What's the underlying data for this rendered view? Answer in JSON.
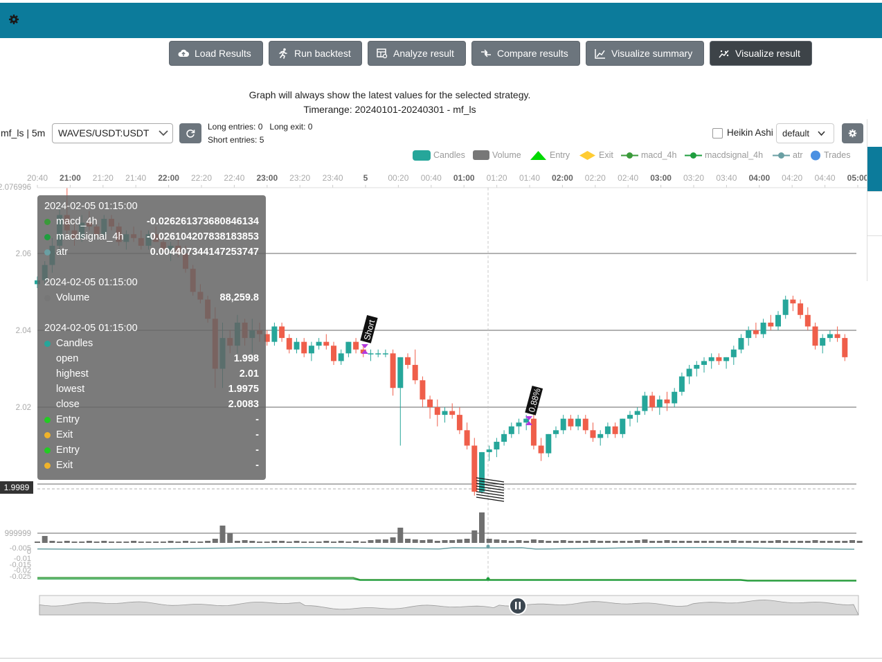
{
  "toolbar": {
    "buttons": [
      {
        "label": "Load Results",
        "icon": "cloud-upload-icon"
      },
      {
        "label": "Run backtest",
        "icon": "running-icon"
      },
      {
        "label": "Analyze result",
        "icon": "table-analyze-icon"
      },
      {
        "label": "Compare results",
        "icon": "compare-icon"
      },
      {
        "label": "Visualize summary",
        "icon": "line-chart-icon"
      },
      {
        "label": "Visualize result",
        "icon": "scatter-chart-icon"
      }
    ]
  },
  "info": {
    "graph_note": "Graph will always show the latest values for the selected strategy.",
    "timerange": "Timerange: 20240101-20240301 - mf_ls"
  },
  "controls": {
    "strategy_label": "mf_ls | 5m",
    "pair": "WAVES/USDT:USDT",
    "long_entries": "Long entries: 0",
    "long_exit": "Long exit: 0",
    "short_entries": "Short entries: 5",
    "heikin_ashi": "Heikin Ashi",
    "layout": "default"
  },
  "legend": [
    {
      "label": "Candles",
      "color": "#26a69a"
    },
    {
      "label": "Volume",
      "color": "#777777"
    },
    {
      "label": "Entry",
      "color": "#00d900"
    },
    {
      "label": "Exit",
      "color": "#ffcc33"
    },
    {
      "label": "macd_4h",
      "color": "#3a9a3a"
    },
    {
      "label": "macdsignal_4h",
      "color": "#1e9e3e"
    },
    {
      "label": "atr",
      "color": "#6a9fa3"
    },
    {
      "label": "Trades",
      "color": "#4a90e2"
    }
  ],
  "chart_data": {
    "type": "candlestick",
    "x_ticks": [
      "20:40",
      "21:00",
      "21:20",
      "21:40",
      "22:00",
      "22:20",
      "22:40",
      "23:00",
      "23:20",
      "23:40",
      "5",
      "00:20",
      "00:40",
      "01:00",
      "01:20",
      "01:40",
      "02:00",
      "02:20",
      "02:40",
      "03:00",
      "03:20",
      "03:40",
      "04:00",
      "04:20",
      "04:40",
      "05:00"
    ],
    "y_ticks": [
      "2.076996",
      "2.06",
      "2.04",
      "2.02"
    ],
    "volume_ticks": [
      "999999"
    ],
    "indicator_ticks": [
      "-0.005",
      "0",
      "-0.01",
      "-0.015",
      "-0.02",
      "-0.025"
    ],
    "current_price": "1.9989",
    "markers": [
      {
        "label": "Short",
        "time": "00:00"
      },
      {
        "label": "0.88%",
        "time": "01:40"
      }
    ],
    "candles": [
      [
        2.052,
        2.054,
        2.051,
        2.053
      ],
      [
        2.053,
        2.058,
        2.052,
        2.057
      ],
      [
        2.057,
        2.064,
        2.055,
        2.062
      ],
      [
        2.062,
        2.072,
        2.06,
        2.07
      ],
      [
        2.07,
        2.077,
        2.065,
        2.066
      ],
      [
        2.066,
        2.068,
        2.062,
        2.064
      ],
      [
        2.064,
        2.07,
        2.063,
        2.068
      ],
      [
        2.068,
        2.071,
        2.066,
        2.067
      ],
      [
        2.067,
        2.069,
        2.064,
        2.065
      ],
      [
        2.065,
        2.07,
        2.064,
        2.069
      ],
      [
        2.069,
        2.07,
        2.066,
        2.067
      ],
      [
        2.067,
        2.068,
        2.062,
        2.063
      ],
      [
        2.063,
        2.066,
        2.061,
        2.065
      ],
      [
        2.065,
        2.067,
        2.063,
        2.064
      ],
      [
        2.064,
        2.066,
        2.061,
        2.062
      ],
      [
        2.062,
        2.066,
        2.061,
        2.065
      ],
      [
        2.065,
        2.067,
        2.063,
        2.063
      ],
      [
        2.063,
        2.064,
        2.06,
        2.061
      ],
      [
        2.061,
        2.063,
        2.058,
        2.062
      ],
      [
        2.062,
        2.064,
        2.059,
        2.06
      ],
      [
        2.06,
        2.062,
        2.055,
        2.056
      ],
      [
        2.056,
        2.057,
        2.049,
        2.05
      ],
      [
        2.05,
        2.052,
        2.047,
        2.048
      ],
      [
        2.048,
        2.049,
        2.042,
        2.043
      ],
      [
        2.043,
        2.046,
        2.025,
        2.03
      ],
      [
        2.03,
        2.042,
        2.025,
        2.038
      ],
      [
        2.038,
        2.04,
        2.034,
        2.036
      ],
      [
        2.036,
        2.044,
        2.034,
        2.042
      ],
      [
        2.042,
        2.043,
        2.036,
        2.038
      ],
      [
        2.038,
        2.043,
        2.034,
        2.04
      ],
      [
        2.04,
        2.042,
        2.037,
        2.039
      ],
      [
        2.039,
        2.04,
        2.036,
        2.037
      ],
      [
        2.037,
        2.042,
        2.036,
        2.041
      ],
      [
        2.041,
        2.042,
        2.037,
        2.038
      ],
      [
        2.038,
        2.039,
        2.034,
        2.035
      ],
      [
        2.035,
        2.038,
        2.034,
        2.037
      ],
      [
        2.037,
        2.038,
        2.033,
        2.034
      ],
      [
        2.034,
        2.037,
        2.032,
        2.036
      ],
      [
        2.036,
        2.038,
        2.035,
        2.037
      ],
      [
        2.037,
        2.039,
        2.035,
        2.036
      ],
      [
        2.036,
        2.037,
        2.031,
        2.032
      ],
      [
        2.032,
        2.035,
        2.031,
        2.034
      ],
      [
        2.034,
        2.037,
        2.033,
        2.037
      ],
      [
        2.037,
        2.038,
        2.034,
        2.035
      ],
      [
        2.035,
        2.036,
        2.033,
        2.034
      ],
      [
        2.034,
        2.035,
        2.032,
        2.034
      ],
      [
        2.034,
        2.035,
        2.033,
        2.034
      ],
      [
        2.034,
        2.035,
        2.033,
        2.034
      ],
      [
        2.034,
        2.035,
        2.023,
        2.025
      ],
      [
        2.025,
        2.033,
        2.01,
        2.033
      ],
      [
        2.033,
        2.034,
        2.03,
        2.031
      ],
      [
        2.031,
        2.035,
        2.026,
        2.027
      ],
      [
        2.027,
        2.028,
        2.02,
        2.022
      ],
      [
        2.022,
        2.023,
        2.017,
        2.02
      ],
      [
        2.02,
        2.022,
        2.015,
        2.018
      ],
      [
        2.018,
        2.02,
        2.016,
        2.019
      ],
      [
        2.019,
        2.021,
        2.017,
        2.018
      ],
      [
        2.018,
        2.02,
        2.013,
        2.014
      ],
      [
        2.014,
        2.016,
        2.009,
        2.01
      ],
      [
        2.01,
        2.012,
        1.997,
        1.998
      ],
      [
        1.998,
        2.0083,
        1.9975,
        2.0083
      ],
      [
        2.0083,
        2.01,
        2.006,
        2.009
      ],
      [
        2.009,
        2.012,
        2.007,
        2.011
      ],
      [
        2.011,
        2.014,
        2.01,
        2.013
      ],
      [
        2.013,
        2.016,
        2.012,
        2.015
      ],
      [
        2.015,
        2.017,
        2.013,
        2.016
      ],
      [
        2.016,
        2.018,
        2.014,
        2.017
      ],
      [
        2.017,
        2.018,
        2.009,
        2.01
      ],
      [
        2.01,
        2.012,
        2.006,
        2.008
      ],
      [
        2.008,
        2.013,
        2.007,
        2.013
      ],
      [
        2.013,
        2.015,
        2.012,
        2.014
      ],
      [
        2.014,
        2.018,
        2.013,
        2.017
      ],
      [
        2.017,
        2.018,
        2.014,
        2.015
      ],
      [
        2.015,
        2.018,
        2.014,
        2.017
      ],
      [
        2.017,
        2.018,
        2.013,
        2.014
      ],
      [
        2.014,
        2.016,
        2.011,
        2.012
      ],
      [
        2.012,
        2.014,
        2.01,
        2.013
      ],
      [
        2.013,
        2.016,
        2.012,
        2.015
      ],
      [
        2.015,
        2.016,
        2.012,
        2.013
      ],
      [
        2.013,
        2.017,
        2.012,
        2.017
      ],
      [
        2.017,
        2.019,
        2.015,
        2.018
      ],
      [
        2.018,
        2.02,
        2.016,
        2.019
      ],
      [
        2.019,
        2.024,
        2.018,
        2.023
      ],
      [
        2.023,
        2.024,
        2.019,
        2.02
      ],
      [
        2.02,
        2.023,
        2.018,
        2.022
      ],
      [
        2.022,
        2.024,
        2.019,
        2.021
      ],
      [
        2.021,
        2.025,
        2.02,
        2.024
      ],
      [
        2.024,
        2.029,
        2.023,
        2.028
      ],
      [
        2.028,
        2.031,
        2.026,
        2.03
      ],
      [
        2.03,
        2.032,
        2.028,
        2.031
      ],
      [
        2.031,
        2.033,
        2.029,
        2.032
      ],
      [
        2.032,
        2.034,
        2.03,
        2.033
      ],
      [
        2.033,
        2.034,
        2.031,
        2.032
      ],
      [
        2.032,
        2.033,
        2.03,
        2.033
      ],
      [
        2.033,
        2.036,
        2.031,
        2.035
      ],
      [
        2.035,
        2.039,
        2.034,
        2.038
      ],
      [
        2.038,
        2.041,
        2.036,
        2.04
      ],
      [
        2.04,
        2.042,
        2.038,
        2.039
      ],
      [
        2.039,
        2.043,
        2.038,
        2.042
      ],
      [
        2.042,
        2.044,
        2.04,
        2.041
      ],
      [
        2.041,
        2.045,
        2.04,
        2.044
      ],
      [
        2.044,
        2.049,
        2.043,
        2.048
      ],
      [
        2.048,
        2.049,
        2.045,
        2.047
      ],
      [
        2.047,
        2.048,
        2.043,
        2.044
      ],
      [
        2.044,
        2.046,
        2.04,
        2.041
      ],
      [
        2.041,
        2.042,
        2.035,
        2.036
      ],
      [
        2.036,
        2.039,
        2.034,
        2.038
      ],
      [
        2.038,
        2.04,
        2.037,
        2.039
      ],
      [
        2.039,
        2.041,
        2.037,
        2.038
      ],
      [
        2.038,
        2.039,
        2.032,
        2.033
      ]
    ]
  },
  "tooltip": {
    "time1": "2024-02-05 01:15:00",
    "macd_name": "macd_4h",
    "macd_val": "-0.026261373680846134",
    "macdsig_name": "macdsignal_4h",
    "macdsig_val": "-0.026104207838183853",
    "atr_name": "atr",
    "atr_val": "0.004407344147253747",
    "time2": "2024-02-05 01:15:00",
    "volume_name": "Volume",
    "volume_val": "88,259.8",
    "time3": "2024-02-05 01:15:00",
    "candles_name": "Candles",
    "open_name": "open",
    "open_val": "1.998",
    "high_name": "highest",
    "high_val": "2.01",
    "low_name": "lowest",
    "low_val": "1.9975",
    "close_name": "close",
    "close_val": "2.0083",
    "entry1_name": "Entry",
    "entry1_val": "-",
    "exit1_name": "Exit",
    "exit1_val": "-",
    "entry2_name": "Entry",
    "entry2_val": "-",
    "exit2_name": "Exit",
    "exit2_val": "-"
  },
  "colors": {
    "topbar": "#0c7b9b",
    "up": "#26a69a",
    "down": "#ef5e4a",
    "button": "#6c757d"
  }
}
